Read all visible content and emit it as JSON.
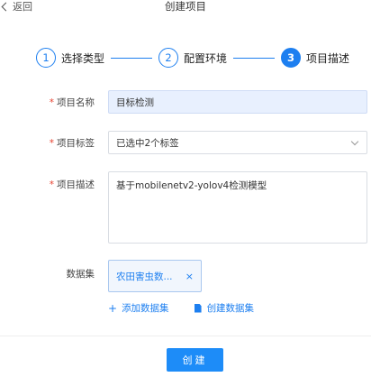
{
  "header": {
    "back_label": "返回",
    "title": "创建项目"
  },
  "steps": [
    {
      "number": "1",
      "label": "选择类型"
    },
    {
      "number": "2",
      "label": "配置环境"
    },
    {
      "number": "3",
      "label": "项目描述"
    }
  ],
  "form": {
    "name": {
      "label": "项目名称",
      "value": "目标检测"
    },
    "tags": {
      "label": "项目标签",
      "value": "已选中2个标签"
    },
    "description": {
      "label": "项目描述",
      "value": "基于mobilenetv2-yolov4检测模型"
    },
    "dataset": {
      "label": "数据集",
      "selected": "农田害虫数...",
      "remove": "×"
    },
    "add_dataset": "添加数据集",
    "create_dataset": "创建数据集",
    "required_mark": "*"
  },
  "footer": {
    "create_label": "创建"
  },
  "colors": {
    "accent": "#1d7ff0",
    "required": "#e8412f",
    "input_filled_bg": "#e8f0fe"
  }
}
